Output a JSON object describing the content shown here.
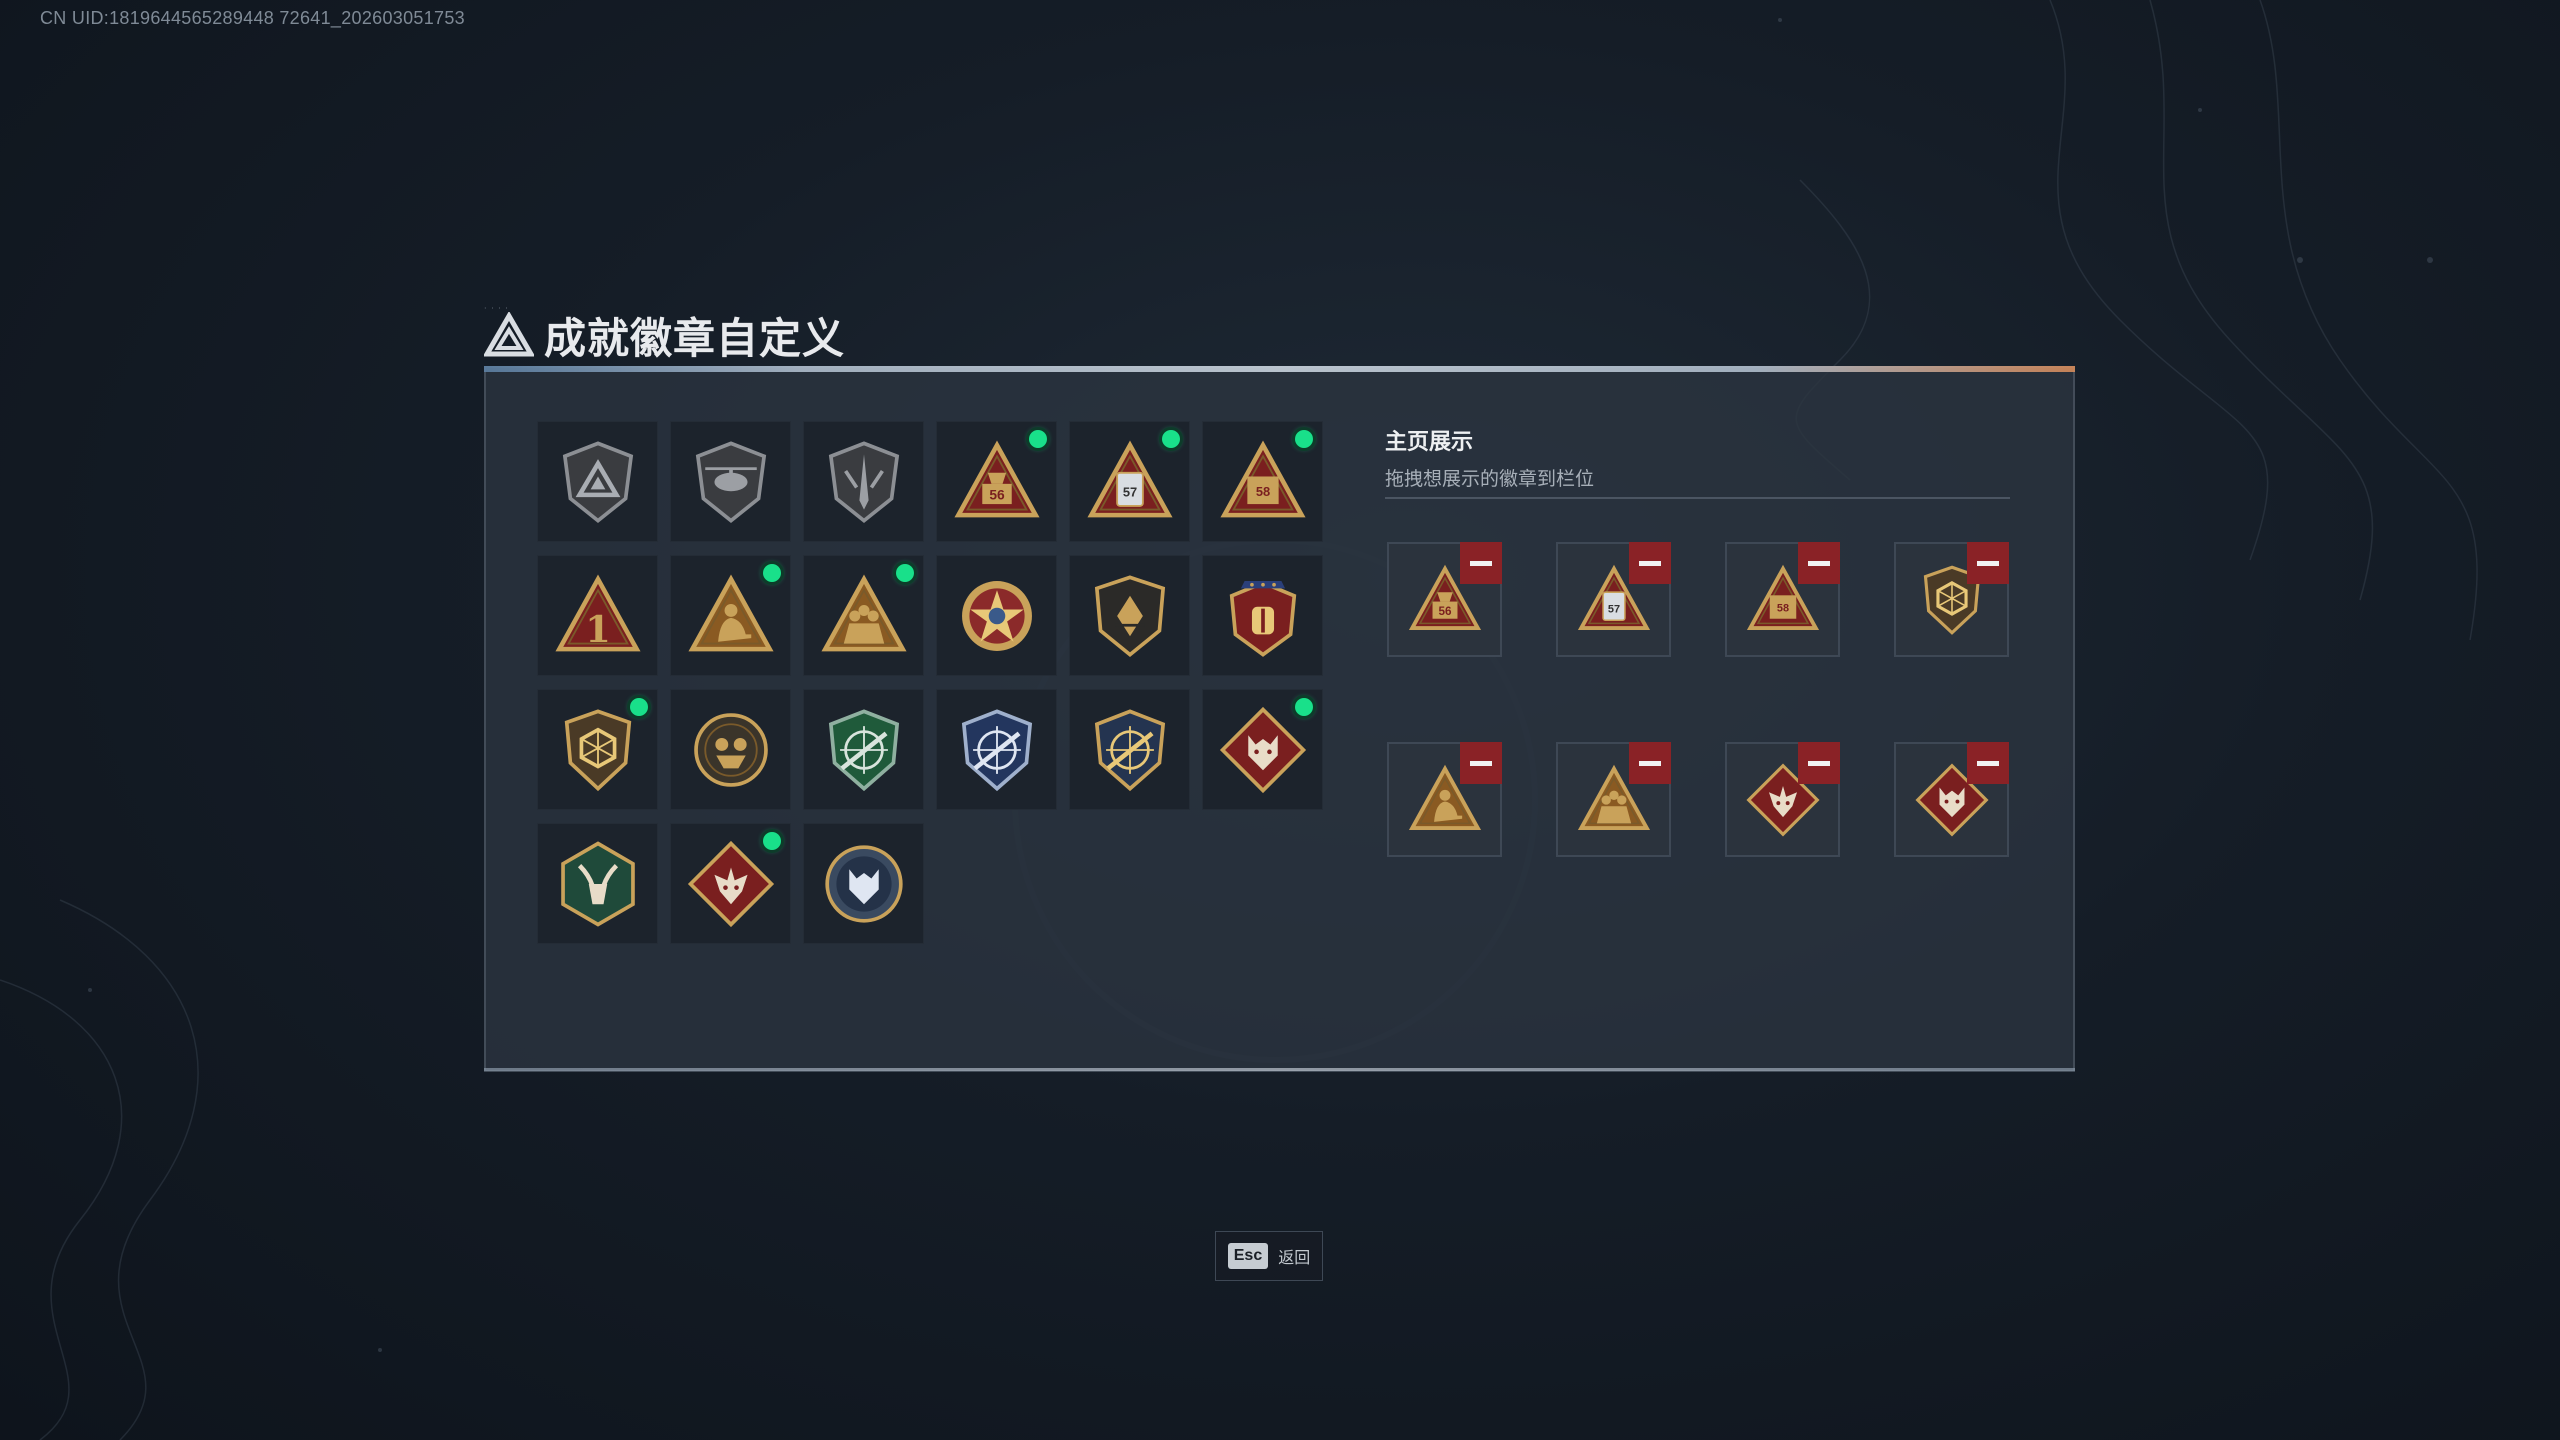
{
  "uid": "CN UID:1819644565289448 72641_202603051753",
  "window": {
    "title": "成就徽章自定义",
    "brand_small": "·  ·  ·  ·"
  },
  "badges": [
    {
      "icon": "delta-shield-badge",
      "new": false
    },
    {
      "icon": "helicopter-shield-badge",
      "new": false
    },
    {
      "icon": "sword-shield-badge",
      "new": false
    },
    {
      "icon": "triangle-56-badge",
      "new": true
    },
    {
      "icon": "triangle-57-badge",
      "new": true
    },
    {
      "icon": "triangle-58-badge",
      "new": true
    },
    {
      "icon": "triangle-1-badge",
      "new": false
    },
    {
      "icon": "triangle-soldier-badge",
      "new": true
    },
    {
      "icon": "triangle-squad-badge",
      "new": true
    },
    {
      "icon": "star-wreath-badge",
      "new": false
    },
    {
      "icon": "dark-crest-badge",
      "new": false
    },
    {
      "icon": "stars-eagle-crest-badge",
      "new": false
    },
    {
      "icon": "hexagon-shield-badge",
      "new": true
    },
    {
      "icon": "round-emblem-badge",
      "new": false
    },
    {
      "icon": "green-rifle-badge",
      "new": false
    },
    {
      "icon": "blue-rifle-badge",
      "new": false
    },
    {
      "icon": "gold-rifle-badge",
      "new": false
    },
    {
      "icon": "wolf-diamond-badge",
      "new": true
    },
    {
      "icon": "goat-hexagon-badge",
      "new": false
    },
    {
      "icon": "dragon-diamond-badge",
      "new": true
    },
    {
      "icon": "wolf-round-badge",
      "new": false
    }
  ],
  "showcase": {
    "title": "主页展示",
    "subtitle": "拖拽想展示的徽章到栏位",
    "slots": [
      {
        "icon": "triangle-56-badge"
      },
      {
        "icon": "triangle-57-badge"
      },
      {
        "icon": "triangle-58-badge"
      },
      {
        "icon": "hexagon-shield-badge"
      },
      {
        "icon": "triangle-soldier-badge"
      },
      {
        "icon": "triangle-squad-badge"
      },
      {
        "icon": "dragon-diamond-badge"
      },
      {
        "icon": "wolf-diamond-badge"
      }
    ]
  },
  "footer": {
    "esc_key": "Esc",
    "esc_label": "返回"
  },
  "colors": {
    "new_dot": "#19e08a",
    "remove_button": "#8a2226",
    "gold": "#c9a25a"
  }
}
